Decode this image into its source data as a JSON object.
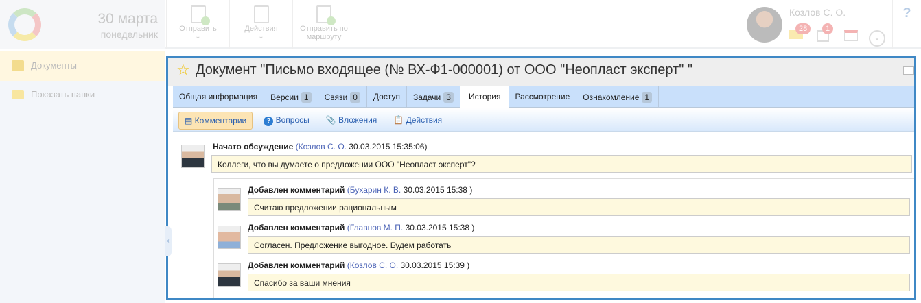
{
  "header": {
    "date_day": "30 марта",
    "date_weekday": "понедельник",
    "toolbar": [
      {
        "label": "Отправить",
        "icon": "send-doc-icon",
        "dropdown": true
      },
      {
        "label": "Действия",
        "icon": "actions-clipboard-icon",
        "dropdown": true
      },
      {
        "label": "Отправить по маршруту",
        "icon": "route-doc-icon",
        "dropdown": false
      }
    ],
    "user_name": "Козлов С. О.",
    "mail_count": "28",
    "tasks_count": "1",
    "help": "?"
  },
  "sidebar": {
    "items": [
      {
        "label": "Документы",
        "icon": "folder-open-icon"
      },
      {
        "label": "Показать папки",
        "icon": "folder-icon"
      }
    ]
  },
  "document": {
    "title": "Документ \"Письмо входящее (№ ВХ-Ф1-000001) от ООО \"Неопласт эксперт\" \"",
    "tabs": [
      {
        "label": "Общая информация"
      },
      {
        "label": "Версии",
        "count": "1"
      },
      {
        "label": "Связи",
        "count": "0"
      },
      {
        "label": "Доступ"
      },
      {
        "label": "Задачи",
        "count": "3"
      },
      {
        "label": "История",
        "active": true
      },
      {
        "label": "Рассмотрение"
      },
      {
        "label": "Ознакомление",
        "count": "1"
      }
    ],
    "subtabs": [
      {
        "label": "Комментарии",
        "active": true
      },
      {
        "label": "Вопросы"
      },
      {
        "label": "Вложения"
      },
      {
        "label": "Действия"
      }
    ],
    "discussion": {
      "action": "Начато обсуждение",
      "author": "(Козлов С. О.",
      "time": "30.03.2015 15:35:06)",
      "text": "Коллеги, что вы думаете о предложении ООО \"Неопласт эксперт\"?"
    },
    "comments": [
      {
        "action": "Добавлен комментарий",
        "author": "(Бухарин К. В.",
        "time": "30.03.2015 15:38 )",
        "text": "Считаю предложении рациональным"
      },
      {
        "action": "Добавлен комментарий",
        "author": "(Главнов М. П.",
        "time": "30.03.2015 15:38 )",
        "text": "Согласен. Предложение выгодное. Будем работать"
      },
      {
        "action": "Добавлен комментарий",
        "author": "(Козлов С. О.",
        "time": "30.03.2015 15:39 )",
        "text": "Спасибо за ваши мнения"
      }
    ]
  }
}
